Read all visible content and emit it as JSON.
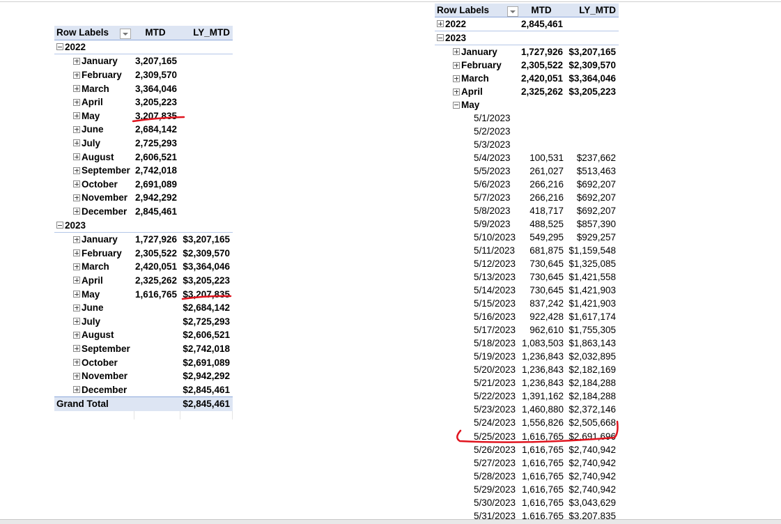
{
  "left_pivot": {
    "headers": {
      "row_labels": "Row Labels",
      "mtd": "MTD",
      "ly_mtd": "LY_MTD"
    },
    "years": [
      {
        "label": "2022",
        "expanded": true,
        "months": [
          {
            "label": "January",
            "mtd": "3,207,165",
            "ly_mtd": ""
          },
          {
            "label": "February",
            "mtd": "2,309,570",
            "ly_mtd": ""
          },
          {
            "label": "March",
            "mtd": "3,364,046",
            "ly_mtd": ""
          },
          {
            "label": "April",
            "mtd": "3,205,223",
            "ly_mtd": ""
          },
          {
            "label": "May",
            "mtd": "3,207,835",
            "ly_mtd": ""
          },
          {
            "label": "June",
            "mtd": "2,684,142",
            "ly_mtd": ""
          },
          {
            "label": "July",
            "mtd": "2,725,293",
            "ly_mtd": ""
          },
          {
            "label": "August",
            "mtd": "2,606,521",
            "ly_mtd": ""
          },
          {
            "label": "September",
            "mtd": "2,742,018",
            "ly_mtd": ""
          },
          {
            "label": "October",
            "mtd": "2,691,089",
            "ly_mtd": ""
          },
          {
            "label": "November",
            "mtd": "2,942,292",
            "ly_mtd": ""
          },
          {
            "label": "December",
            "mtd": "2,845,461",
            "ly_mtd": ""
          }
        ]
      },
      {
        "label": "2023",
        "expanded": true,
        "months": [
          {
            "label": "January",
            "mtd": "1,727,926",
            "ly_mtd": "$3,207,165"
          },
          {
            "label": "February",
            "mtd": "2,305,522",
            "ly_mtd": "$2,309,570"
          },
          {
            "label": "March",
            "mtd": "2,420,051",
            "ly_mtd": "$3,364,046"
          },
          {
            "label": "April",
            "mtd": "2,325,262",
            "ly_mtd": "$3,205,223"
          },
          {
            "label": "May",
            "mtd": "1,616,765",
            "ly_mtd": "$3,207,835"
          },
          {
            "label": "June",
            "mtd": "",
            "ly_mtd": "$2,684,142"
          },
          {
            "label": "July",
            "mtd": "",
            "ly_mtd": "$2,725,293"
          },
          {
            "label": "August",
            "mtd": "",
            "ly_mtd": "$2,606,521"
          },
          {
            "label": "September",
            "mtd": "",
            "ly_mtd": "$2,742,018"
          },
          {
            "label": "October",
            "mtd": "",
            "ly_mtd": "$2,691,089"
          },
          {
            "label": "November",
            "mtd": "",
            "ly_mtd": "$2,942,292"
          },
          {
            "label": "December",
            "mtd": "",
            "ly_mtd": "$2,845,461"
          }
        ]
      }
    ],
    "grand_total": {
      "label": "Grand Total",
      "mtd": "",
      "ly_mtd": "$2,845,461"
    }
  },
  "right_pivot": {
    "headers": {
      "row_labels": "Row Labels",
      "mtd": "MTD",
      "ly_mtd": "LY_MTD"
    },
    "year_2022": {
      "label": "2022",
      "mtd": "2,845,461",
      "ly_mtd": ""
    },
    "year_2023": {
      "label": "2023"
    },
    "months": [
      {
        "label": "January",
        "mtd": "1,727,926",
        "ly_mtd": "$3,207,165"
      },
      {
        "label": "February",
        "mtd": "2,305,522",
        "ly_mtd": "$2,309,570"
      },
      {
        "label": "March",
        "mtd": "2,420,051",
        "ly_mtd": "$3,364,046"
      },
      {
        "label": "April",
        "mtd": "2,325,262",
        "ly_mtd": "$3,205,223"
      }
    ],
    "may": {
      "label": "May",
      "days": [
        {
          "date": "5/1/2023",
          "mtd": "",
          "ly_mtd": ""
        },
        {
          "date": "5/2/2023",
          "mtd": "",
          "ly_mtd": ""
        },
        {
          "date": "5/3/2023",
          "mtd": "",
          "ly_mtd": ""
        },
        {
          "date": "5/4/2023",
          "mtd": "100,531",
          "ly_mtd": "$237,662"
        },
        {
          "date": "5/5/2023",
          "mtd": "261,027",
          "ly_mtd": "$513,463"
        },
        {
          "date": "5/6/2023",
          "mtd": "266,216",
          "ly_mtd": "$692,207"
        },
        {
          "date": "5/7/2023",
          "mtd": "266,216",
          "ly_mtd": "$692,207"
        },
        {
          "date": "5/8/2023",
          "mtd": "418,717",
          "ly_mtd": "$692,207"
        },
        {
          "date": "5/9/2023",
          "mtd": "488,525",
          "ly_mtd": "$857,390"
        },
        {
          "date": "5/10/2023",
          "mtd": "549,295",
          "ly_mtd": "$929,257"
        },
        {
          "date": "5/11/2023",
          "mtd": "681,875",
          "ly_mtd": "$1,159,548"
        },
        {
          "date": "5/12/2023",
          "mtd": "730,645",
          "ly_mtd": "$1,325,085"
        },
        {
          "date": "5/13/2023",
          "mtd": "730,645",
          "ly_mtd": "$1,421,558"
        },
        {
          "date": "5/14/2023",
          "mtd": "730,645",
          "ly_mtd": "$1,421,903"
        },
        {
          "date": "5/15/2023",
          "mtd": "837,242",
          "ly_mtd": "$1,421,903"
        },
        {
          "date": "5/16/2023",
          "mtd": "922,428",
          "ly_mtd": "$1,617,174"
        },
        {
          "date": "5/17/2023",
          "mtd": "962,610",
          "ly_mtd": "$1,755,305"
        },
        {
          "date": "5/18/2023",
          "mtd": "1,083,503",
          "ly_mtd": "$1,863,143"
        },
        {
          "date": "5/19/2023",
          "mtd": "1,236,843",
          "ly_mtd": "$2,032,895"
        },
        {
          "date": "5/20/2023",
          "mtd": "1,236,843",
          "ly_mtd": "$2,182,169"
        },
        {
          "date": "5/21/2023",
          "mtd": "1,236,843",
          "ly_mtd": "$2,184,288"
        },
        {
          "date": "5/22/2023",
          "mtd": "1,391,162",
          "ly_mtd": "$2,184,288"
        },
        {
          "date": "5/23/2023",
          "mtd": "1,460,880",
          "ly_mtd": "$2,372,146"
        },
        {
          "date": "5/24/2023",
          "mtd": "1,556,826",
          "ly_mtd": "$2,505,668"
        },
        {
          "date": "5/25/2023",
          "mtd": "1,616,765",
          "ly_mtd": "$2,691,696"
        },
        {
          "date": "5/26/2023",
          "mtd": "1,616,765",
          "ly_mtd": "$2,740,942"
        },
        {
          "date": "5/27/2023",
          "mtd": "1,616,765",
          "ly_mtd": "$2,740,942"
        },
        {
          "date": "5/28/2023",
          "mtd": "1,616,765",
          "ly_mtd": "$2,740,942"
        },
        {
          "date": "5/29/2023",
          "mtd": "1,616,765",
          "ly_mtd": "$2,740,942"
        },
        {
          "date": "5/30/2023",
          "mtd": "1,616,765",
          "ly_mtd": "$3,043,629"
        },
        {
          "date": "5/31/2023",
          "mtd": "1,616,765",
          "ly_mtd": "$3,207,835"
        }
      ]
    }
  },
  "annotation_color": "#e0141e"
}
